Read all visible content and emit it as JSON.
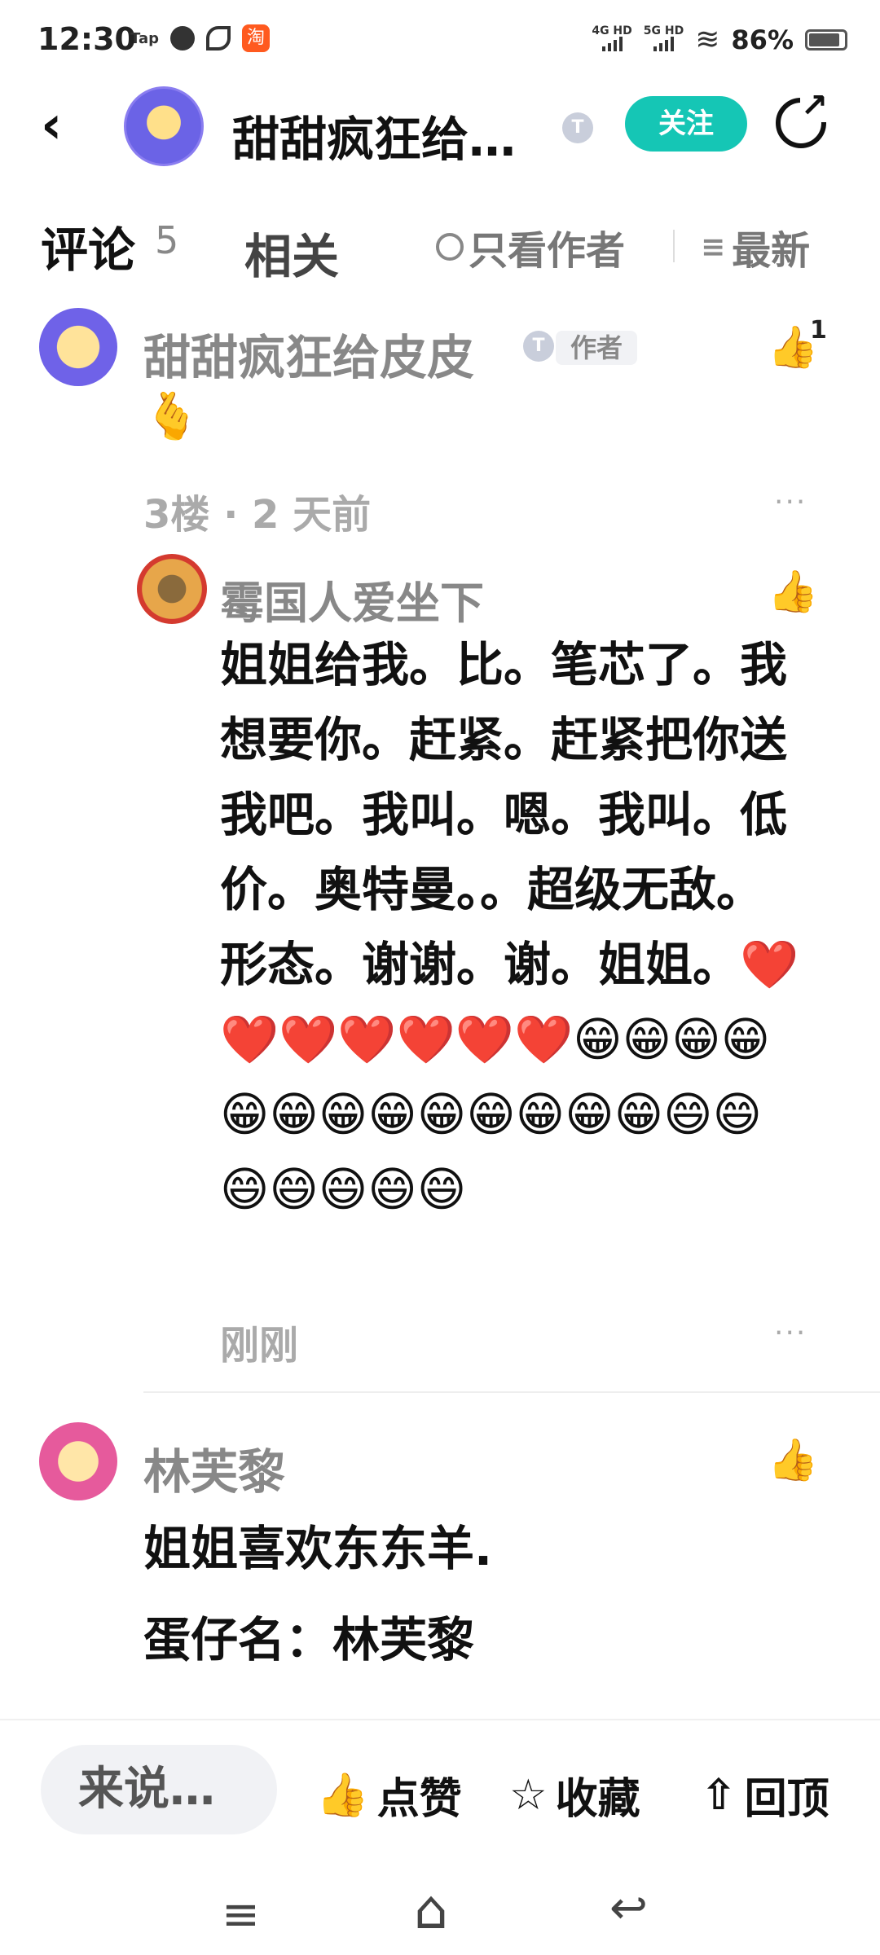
{
  "status_bar": {
    "time": "12:30",
    "app_tap": "Tap",
    "app_taobao": "淘",
    "net_4g": "4G HD",
    "net_5g": "5G HD",
    "battery": "86%"
  },
  "header": {
    "back_icon": "back-arrow-icon",
    "title": "甜甜疯狂给…",
    "badge": "T",
    "follow_label": "关注",
    "share_icon": "share-icon"
  },
  "tabs": {
    "comments_label": "评论",
    "comments_count": "5",
    "related_label": "相关",
    "only_author_label": "只看作者",
    "sort_label": "最新"
  },
  "comment1": {
    "author": "甜甜疯狂给皮皮",
    "badge": "T",
    "author_tag": "作者",
    "like_count": "1",
    "emoji": "🫰",
    "floor": "3楼 · 2 天前"
  },
  "reply1": {
    "author": "霉国人爱坐下",
    "text": "姐姐给我。比。笔芯了。我想要你。赶紧。赶紧把你送我吧。我叫。嗯。我叫。低价。奥特曼。。超级无敌。形态。谢谢。谢。姐姐。❤️❤️❤️❤️❤️❤️❤️😁😁😁😁😁😁😁😁😁😁😁😁😁😄😄😄😄😄😄😄",
    "time": "刚刚"
  },
  "comment2": {
    "author": "林芙黎",
    "line1": "姐姐喜欢东东羊.",
    "line2": "蛋仔名：林芙黎"
  },
  "bottom_bar": {
    "input_placeholder": "来说…",
    "like_label": "点赞",
    "favorite_label": "收藏",
    "top_label": "回顶"
  },
  "icons": {
    "more": "···",
    "like": "👍"
  },
  "colors": {
    "accent": "#15c6b5"
  }
}
